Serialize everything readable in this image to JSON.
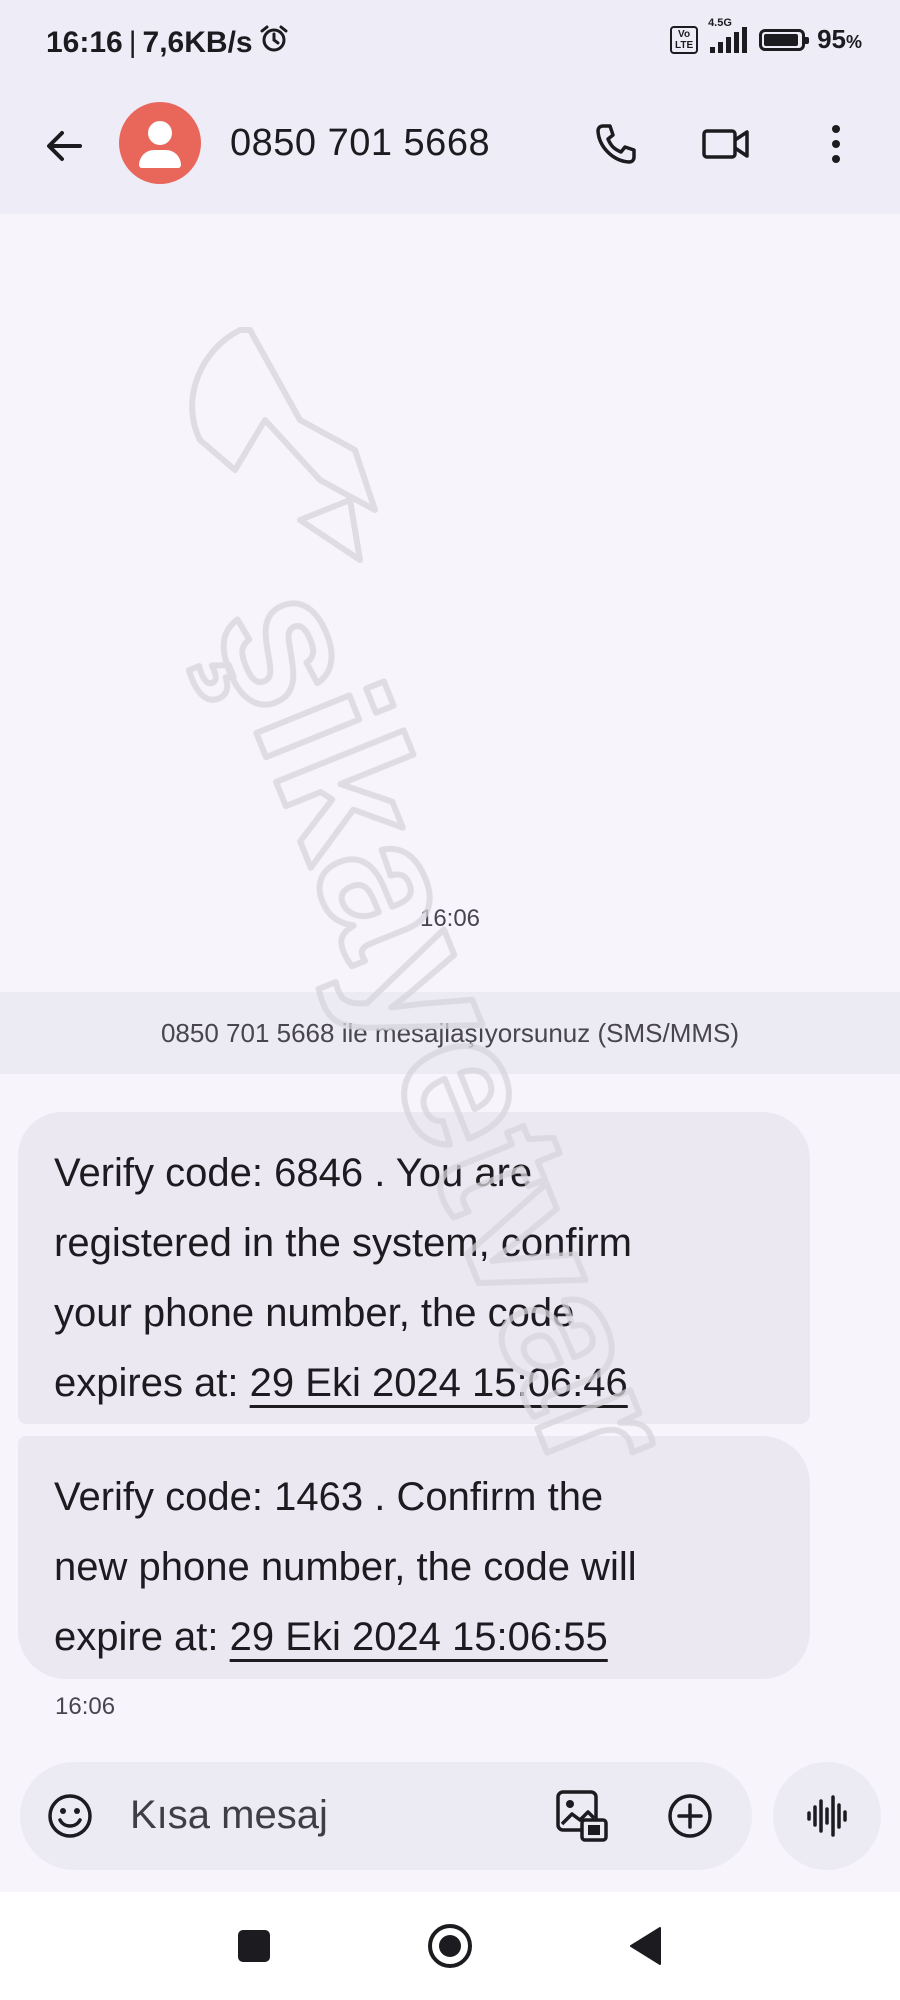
{
  "status_bar": {
    "time": "16:16",
    "separator": "|",
    "net_speed": "7,6KB/s",
    "volte": "Vo LTE",
    "network": "4.5G",
    "battery": "95",
    "battery_unit": "%"
  },
  "app_bar": {
    "contact": "0850 701 5668",
    "icons": [
      "back-arrow-icon",
      "avatar-person-icon",
      "phone-icon",
      "video-camera-icon",
      "more-vert-icon"
    ],
    "avatar_color": "#e9665b"
  },
  "watermark": "şikayetvar",
  "conversation": {
    "top_timestamp": "16:06",
    "info_banner": "0850 701 5668 ile mesajlaşıyorsunuz (SMS/MMS)",
    "messages": [
      {
        "line1": "Verify code: 6846 . You are",
        "line2": "registered in the system, confirm",
        "line3": "your phone number, the code",
        "line4_prefix": "expires at: ",
        "link": "29 Eki 2024 15:06:46"
      },
      {
        "line1": "Verify code: 1463 . Confirm the",
        "line2": "new phone number, the code will",
        "line3_prefix": "expire at: ",
        "link": "29 Eki 2024 15:06:55"
      }
    ],
    "message_time": "16:06"
  },
  "compose": {
    "placeholder": "Kısa mesaj"
  },
  "nav_bar": {
    "buttons": [
      "recents-square-icon",
      "home-circle-icon",
      "back-triangle-icon"
    ]
  }
}
